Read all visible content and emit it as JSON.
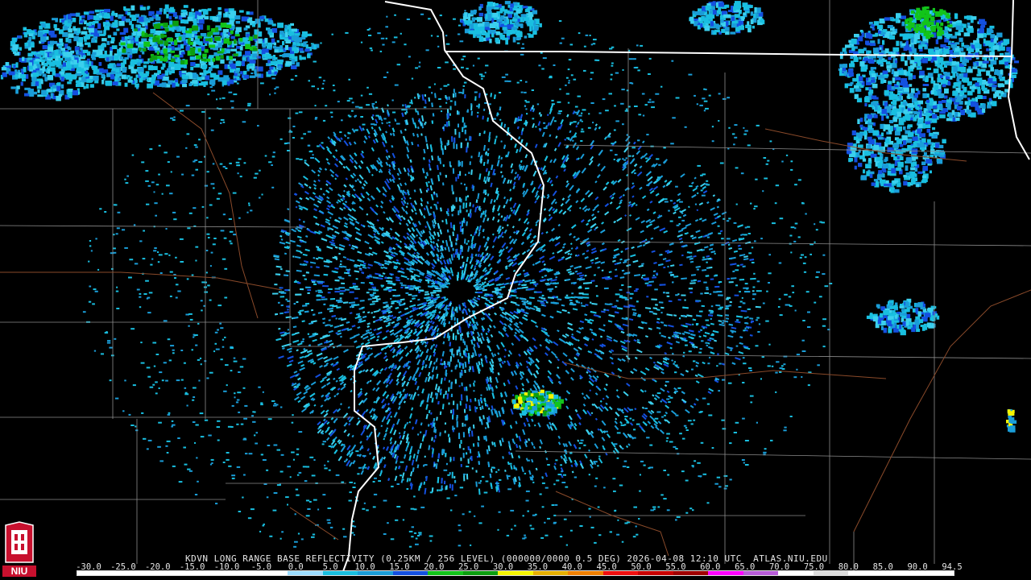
{
  "caption": "KDVN LONG RANGE BASE REFLECTIVITY (0.25KM / 256 LEVEL) (000000/0000 0.5 DEG) 2026-04-08 12:10 UTC  ATLAS.NIU.EDU",
  "logo_text": "NIU",
  "scale": {
    "labels": [
      "-30.0",
      "-25.0",
      "-20.0",
      "-15.0",
      "-10.0",
      "-5.0",
      "0.0",
      "5.0",
      "10.0",
      "15.0",
      "20.0",
      "25.0",
      "30.0",
      "35.0",
      "40.0",
      "45.0",
      "50.0",
      "55.0",
      "60.0",
      "65.0",
      "70.0",
      "75.0",
      "80.0",
      "85.0",
      "90.0",
      "94.5"
    ],
    "colors": [
      "#ffffff",
      "#ffffff",
      "#ffffff",
      "#ffffff",
      "#ffffff",
      "#ffffff",
      "#9bdcff",
      "#19bfe0",
      "#1a9dd8",
      "#1450e0",
      "#12c41a",
      "#0c9e10",
      "#f4f400",
      "#e6b000",
      "#f08000",
      "#f01010",
      "#c80000",
      "#a00000",
      "#ff00ff",
      "#b85cd8",
      "#ffffff",
      "#dcdcdc",
      "#ffffff",
      "#ffffff",
      "#ffffff"
    ]
  },
  "colors": {
    "background": "#000000",
    "county_lines": "#8c8c8c",
    "state_lines": "#ffffff",
    "river_lines": "#8a4a2a"
  },
  "radar_site": "KDVN"
}
